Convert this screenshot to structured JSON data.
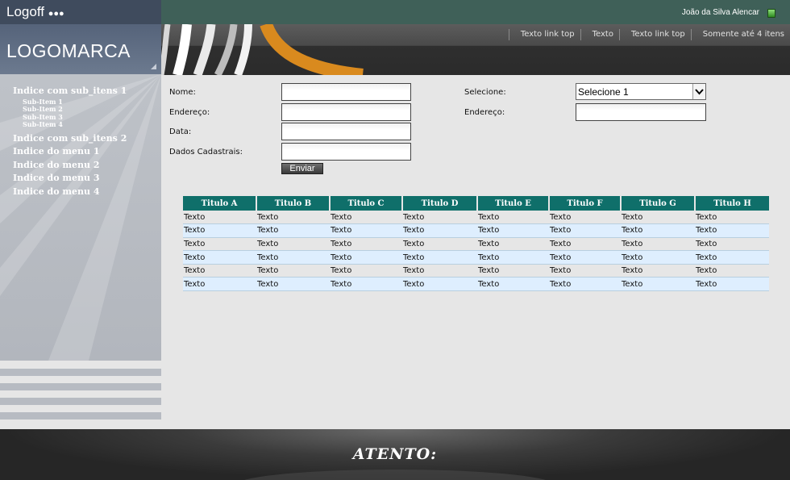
{
  "header": {
    "logoff_label": "Logoff",
    "logoff_dots": "●●●",
    "logo_text": "LOGOMARCA",
    "user_name": "João da Silva Alencar",
    "status_color": "#3ea82f",
    "links": [
      "Texto link top",
      "Texto",
      "Texto link top",
      "Somente até 4 itens"
    ]
  },
  "sidebar": {
    "items": [
      {
        "label": "Indice com sub_itens 1",
        "sub_items": [
          "Sub-Item 1",
          "Sub-Item 2",
          "Sub-Item 3",
          "Sub-Item 4"
        ]
      },
      {
        "label": "Indice com sub_itens 2"
      },
      {
        "label": "Indice do menu 1"
      },
      {
        "label": "Indice do menu 2"
      },
      {
        "label": "Indice do menu 3"
      },
      {
        "label": "Indice do menu 4"
      }
    ]
  },
  "form": {
    "nome_label": "Nome:",
    "endereco_label": "Endereço:",
    "data_label": "Data:",
    "dados_label": "Dados Cadastrais:",
    "selecione_label": "Selecione:",
    "endereco2_label": "Endereço:",
    "select_value": "Selecione 1",
    "submit_label": "Enviar",
    "nome_value": "",
    "endereco_value": "",
    "data_value": "",
    "dados_value": "",
    "endereco2_value": ""
  },
  "table": {
    "headers": [
      "Titulo A",
      "Titulo B",
      "Titulo C",
      "Titulo D",
      "Titulo E",
      "Titulo F",
      "Titulo G",
      "Titulo H"
    ],
    "rows": [
      [
        "Texto",
        "Texto",
        "Texto",
        "Texto",
        "Texto",
        "Texto",
        "Texto",
        "Texto"
      ],
      [
        "Texto",
        "Texto",
        "Texto",
        "Texto",
        "Texto",
        "Texto",
        "Texto",
        "Texto"
      ],
      [
        "Texto",
        "Texto",
        "Texto",
        "Texto",
        "Texto",
        "Texto",
        "Texto",
        "Texto"
      ],
      [
        "Texto",
        "Texto",
        "Texto",
        "Texto",
        "Texto",
        "Texto",
        "Texto",
        "Texto"
      ],
      [
        "Texto",
        "Texto",
        "Texto",
        "Texto",
        "Texto",
        "Texto",
        "Texto",
        "Texto"
      ],
      [
        "Texto",
        "Texto",
        "Texto",
        "Texto",
        "Texto",
        "Texto",
        "Texto",
        "Texto"
      ]
    ]
  },
  "footer": {
    "brand": "ATENTO:"
  },
  "colors": {
    "topbar": "#3f6058",
    "table_header": "#0f6f6a",
    "accent_orange": "#d98a1e",
    "row_alt": "#deeefe"
  }
}
